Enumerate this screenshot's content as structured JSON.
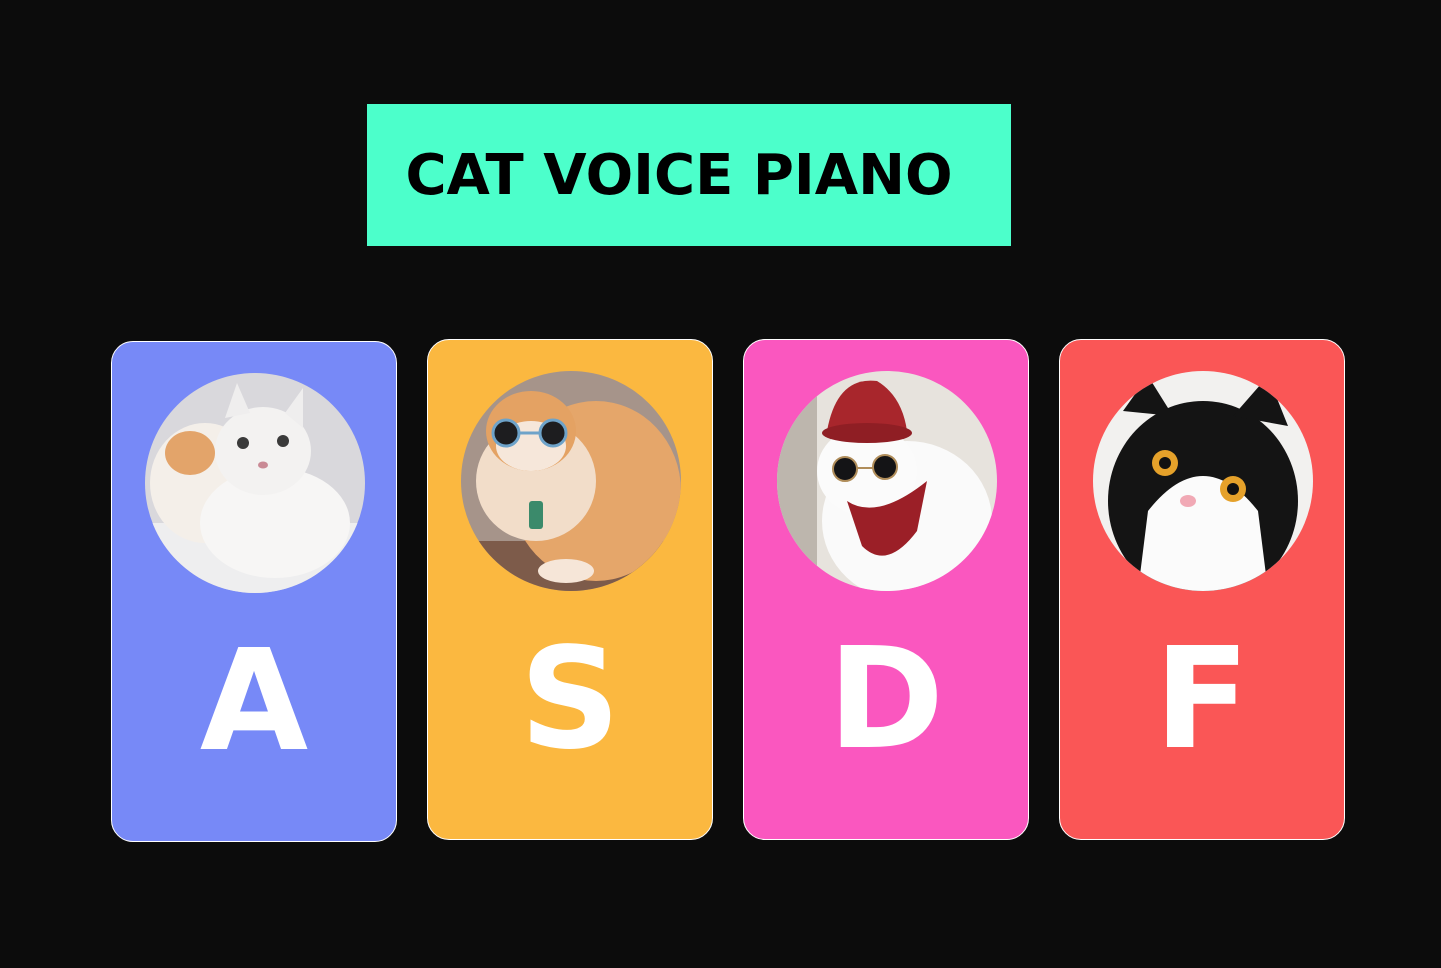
{
  "title": "CAT VOICE PIANO",
  "colors": {
    "background": "#0c0c0c",
    "title_bg": "#4cffcb",
    "key_border": "#ffffff"
  },
  "keys": [
    {
      "letter": "A",
      "color": "#7789f7",
      "photo": "cat-photo-white-cats-cuddling"
    },
    {
      "letter": "S",
      "color": "#fbb840",
      "photo": "cat-photo-orange-cat-sunglasses"
    },
    {
      "letter": "D",
      "color": "#fa57bf",
      "photo": "cat-photo-white-cat-red-hat-sunglasses"
    },
    {
      "letter": "F",
      "color": "#fa5656",
      "photo": "cat-photo-black-white-cat"
    }
  ]
}
